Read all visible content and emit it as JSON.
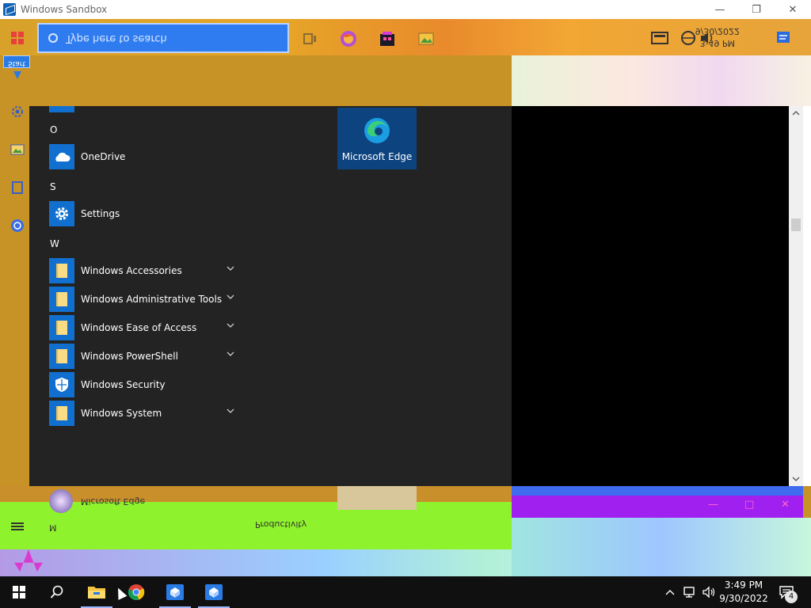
{
  "window": {
    "title": "Windows Sandbox",
    "minimize_glyph": "—",
    "restore_glyph": "❐",
    "close_glyph": "✕"
  },
  "mirrored_taskbar": {
    "search_placeholder": "Type here to search",
    "date": "9/30/2022",
    "time": "3:49 PM",
    "badge": "Start"
  },
  "start_menu": {
    "sections": [
      {
        "letter": "O",
        "items": [
          {
            "label": "OneDrive",
            "icon": "onedrive-icon",
            "expandable": false
          }
        ]
      },
      {
        "letter": "S",
        "items": [
          {
            "label": "Settings",
            "icon": "gear-icon",
            "expandable": false
          }
        ]
      },
      {
        "letter": "W",
        "items": [
          {
            "label": "Windows Accessories",
            "icon": "folder-icon",
            "expandable": true
          },
          {
            "label": "Windows Administrative Tools",
            "icon": "folder-icon",
            "expandable": true
          },
          {
            "label": "Windows Ease of Access",
            "icon": "folder-icon",
            "expandable": true
          },
          {
            "label": "Windows PowerShell",
            "icon": "folder-icon",
            "expandable": true
          },
          {
            "label": "Windows Security",
            "icon": "shield-icon",
            "expandable": false
          },
          {
            "label": "Windows System",
            "icon": "folder-icon",
            "expandable": true
          }
        ]
      }
    ],
    "pinned_tile": {
      "label": "Microsoft Edge",
      "icon": "edge-icon"
    }
  },
  "glitch_area": {
    "mirrored_edge_label": "Microsoft Edge",
    "mirrored_m": "M",
    "mirrored_productivity": "Productivity",
    "inner_window_min": "—",
    "inner_window_max": "□",
    "inner_window_close": "✕"
  },
  "taskbar": {
    "time": "3:49 PM",
    "date": "9/30/2022",
    "notifications": "4",
    "tray_chevron": "^"
  },
  "colors": {
    "start_bg": "#232323",
    "tile_blue": "#1170cf",
    "taskbar_bg": "#101010",
    "edge_tile_bg": "#0d4480"
  }
}
